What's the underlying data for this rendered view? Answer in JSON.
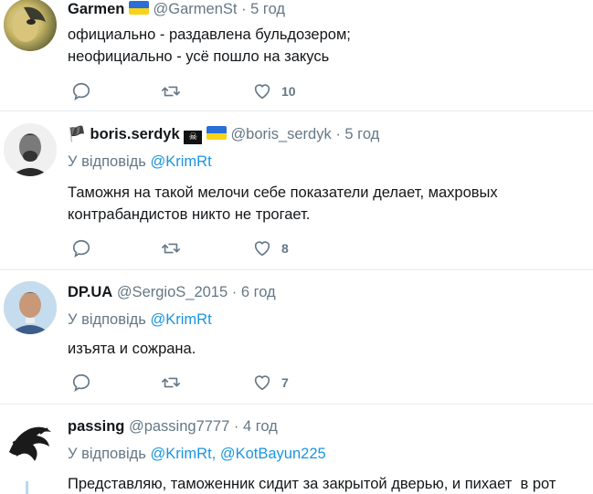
{
  "tweets": [
    {
      "name": "Garmen",
      "handle": "@GarmenSt",
      "time": "· 5 год",
      "reply_prefix": "",
      "reply_to": [],
      "text_lines": [
        "официально - раздавлена бульдозером;",
        "неофициально - усё пошло на закусь"
      ],
      "likes": "10"
    },
    {
      "name": "boris.serdyk",
      "handle": "@boris_serdyk",
      "time": "· 5 год",
      "reply_prefix": "У відповідь",
      "reply_to": [
        "@KrimRt"
      ],
      "text_lines": [
        "Таможня на такой мелочи себе показатели делает, махровых",
        "контрабандистов никто не трогает."
      ],
      "likes": "8"
    },
    {
      "name": "DP.UA",
      "handle": "@SergioS_2015",
      "time": "· 6 год",
      "reply_prefix": "У відповідь",
      "reply_to": [
        "@KrimRt"
      ],
      "text_lines": [
        "изъята и сожрана."
      ],
      "likes": "7"
    },
    {
      "name": "passing",
      "handle": "@passing7777",
      "time": "· 4 год",
      "reply_prefix": "У відповідь",
      "reply_to": [
        "@KrimRt,",
        "@KotBayun225"
      ],
      "text_lines": [
        "Представляю, таможенник сидит за закрытой дверью, и пихает  в рот"
      ],
      "likes": ""
    }
  ],
  "emoji": {
    "flag_emoji": "🏴",
    "skull_emoji": "☠"
  },
  "colors": {
    "link": "#1b95e0",
    "muted": "#657786",
    "text": "#14171a",
    "divider": "#e6ecf0",
    "flag_blue": "#2a6fd6",
    "flag_yellow": "#f7d317"
  }
}
